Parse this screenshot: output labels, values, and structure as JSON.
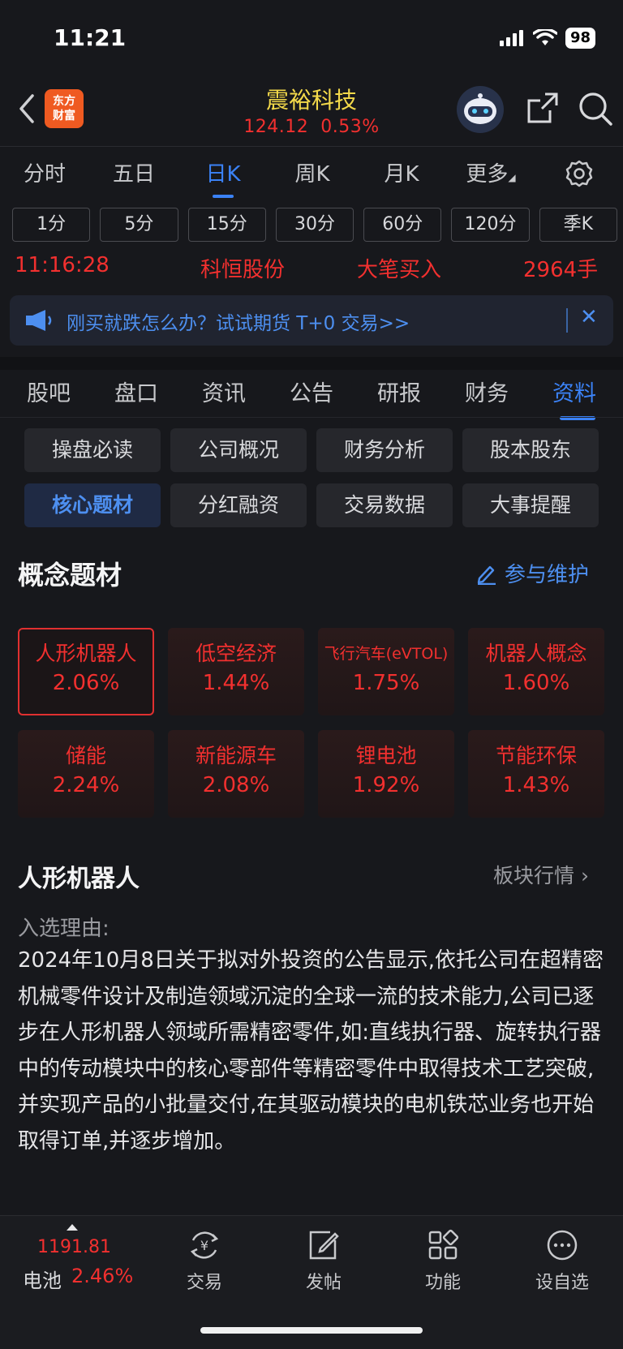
{
  "status_bar": {
    "time": "11:21",
    "battery": "98"
  },
  "header": {
    "logo_text_1": "东方",
    "logo_text_2": "财富",
    "stock_name": "震裕科技",
    "stock_price": "124.12",
    "stock_change": "0.53%"
  },
  "period_tabs": [
    "分时",
    "五日",
    "日K",
    "周K",
    "月K",
    "更多"
  ],
  "minute_buttons": [
    "1分",
    "5分",
    "15分",
    "30分",
    "60分",
    "120分",
    "季K"
  ],
  "ticker": {
    "time": "11:16:28",
    "stock": "科恒股份",
    "action": "大笔买入",
    "volume": "2964手"
  },
  "banner": {
    "text": "刚买就跌怎么办？试试期货 T+0 交易>>"
  },
  "section_tabs": [
    "股吧",
    "盘口",
    "资讯",
    "公告",
    "研报",
    "财务",
    "资料"
  ],
  "sub_buttons": [
    "操盘必读",
    "公司概况",
    "财务分析",
    "股本股东",
    "核心题材",
    "分红融资",
    "交易数据",
    "大事提醒"
  ],
  "concept": {
    "title": "概念题材",
    "maintain_label": "参与维护",
    "cards": [
      {
        "name": "人形机器人",
        "pct": "2.06%"
      },
      {
        "name": "低空经济",
        "pct": "1.44%"
      },
      {
        "name": "飞行汽车(eVTOL)",
        "pct": "1.75%"
      },
      {
        "name": "机器人概念",
        "pct": "1.60%"
      },
      {
        "name": "储能",
        "pct": "2.24%"
      },
      {
        "name": "新能源车",
        "pct": "2.08%"
      },
      {
        "name": "锂电池",
        "pct": "1.92%"
      },
      {
        "name": "节能环保",
        "pct": "1.43%"
      }
    ]
  },
  "detail": {
    "title": "人形机器人",
    "link": "板块行情",
    "reason_label": "入选理由:",
    "reason_text": "2024年10月8日关于拟对外投资的公告显示,依托公司在超精密机械零件设计及制造领域沉淀的全球一流的技术能力,公司已逐步在人形机器人领域所需精密零件,如:直线执行器、旋转执行器中的传动模块中的核心零部件等精密零件中取得技术工艺突破,并实现产品的小批量交付,在其驱动模块的电机铁芯业务也开始取得订单,并逐步增加。"
  },
  "bottom_bar": {
    "index_value": "1191.81",
    "index_name": "电池",
    "index_pct": "2.46%",
    "nav": [
      "交易",
      "发帖",
      "功能",
      "设自选"
    ]
  },
  "colors": {
    "red": "#f2302f",
    "blue": "#3b82f6",
    "yellow": "#f3d94a",
    "bg": "#17181c"
  }
}
